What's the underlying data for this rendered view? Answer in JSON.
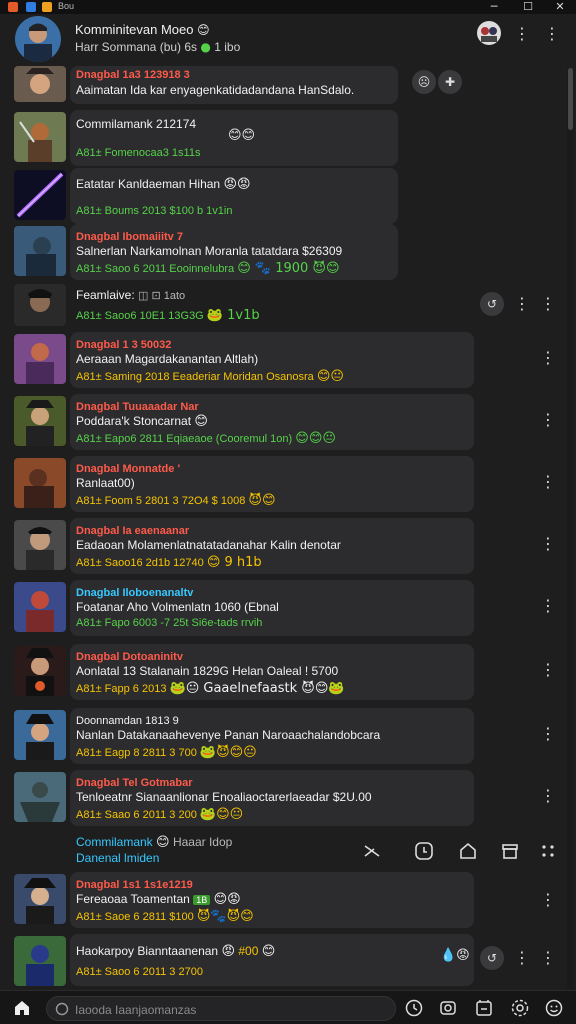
{
  "titlebar": {
    "text": "Bou"
  },
  "header": {
    "title": "Komminitevan Moeo",
    "title_emoji": "😊",
    "subtitle": "Harr Sommana (bu) 6s",
    "subtitle_extra": "1 ibo"
  },
  "messages": [
    {
      "id": "m1",
      "l1": "Dnagbal 1a3 123918 3",
      "l2": "Aaimatan Ida kar enyagenkatidadandana HanSdalo.",
      "l3": "",
      "emojis": ""
    },
    {
      "id": "m2",
      "l1": "Commilamank 212174",
      "l2": "",
      "l3": "A81± Fomenocaa3 1s11s",
      "emojis": "😊😊"
    },
    {
      "id": "m3",
      "l1": "Eatatar Kanldaeman Hihan",
      "l2": "",
      "l3": "A81± Boums 2013 $100 b 1v1in",
      "emojis": "😡😡"
    },
    {
      "id": "m4",
      "l1": "Dnagbal Ibomaiiitv 7",
      "l2": "Salnerlan Narkamolnan Moranla tatatdara $26309",
      "l3": "A81± Saoo 6 2011 Eooinnelubra",
      "emojis": "😊 🐾 1900 😈😊"
    },
    {
      "id": "m5",
      "l1": "Feamlaive:",
      "l2": "",
      "l3": "A81± Saoo6 10E1 13G3G",
      "emojis": "🐸 1v1b"
    },
    {
      "id": "m6",
      "l1": "Dnagbal 1 3 50032",
      "l2": "Aeraaan Magardakanantan Altlah)",
      "l3": "A81± Saming 2018 Eeaderiar Moridan Osanosra",
      "emojis": "😊😐"
    },
    {
      "id": "m7",
      "l1": "Dnagbal Tuuaaadar Nar",
      "l2": "Poddara'k Stoncarnat",
      "l3": "A81± Eapo6 2811 Eqiaeaoe (Cooremul 1on)",
      "emojis": "😊😊😐"
    },
    {
      "id": "m8",
      "l1": "Dnagbal Monnatde '",
      "l2": "Ranlaat00)",
      "l3": "A81± Foom 5 2801 3 72O4 $ 1008",
      "emojis": "😈😊"
    },
    {
      "id": "m9",
      "l1": "Dnagbal Ia eaenaanar",
      "l2": "Eadaoan Molamenlatnatatadanahar Kalin denotar",
      "l3": "A81± Saoo16 2d1b 12740",
      "emojis": "😊 9 h1b"
    },
    {
      "id": "m10",
      "l1": "Dnagbal Iloboenanaltv",
      "l2": "Foatanar Aho Volmenlatn 1060 (Ebnal",
      "l3": "A81± Fapo 6003 -7 25t Si6e-tads rrvih",
      "emojis": ""
    },
    {
      "id": "m11",
      "l1": "Dnagbal Dotoaninitv",
      "l2": "Aonlatal 13 Stalanain 1829G Helan Oaleal ! 5700",
      "l3": "A81± Fapp 6 2013",
      "emojis": "🐸😐 Gaaelnefaastk 😈😊🐸"
    },
    {
      "id": "m12",
      "l1": "Doonnamdan 1813 9",
      "l2": "Nanlan Datakanaahevenye Panan Naroaachalandobcara",
      "l3": "A81± Eagp 8 2811 3 700",
      "emojis": "🐸😈😊😐"
    },
    {
      "id": "m13",
      "l1": "Dnagbal Tel Gotmabar",
      "l2": "Tenloeatnr Sianaanlionar Enoaliaoctarerlaeadar $2U.00",
      "l3": "A81± Saao 6 2011 3 200",
      "emojis": "🐸😊😐"
    },
    {
      "id": "m14",
      "l1": "Dnagbal 1s1 1s1e1219",
      "l2": "Fereaoaa Toamentan",
      "l3": "A81± Saoe 6 2811 $100",
      "emojis": "😈🐾😈😊"
    },
    {
      "id": "m15",
      "l1": "Haokarpoy Bianntaanenan",
      "l2": "",
      "l3": "A81± Saoo 6 2011 3 2700",
      "emojis": ""
    }
  ],
  "toolbar_row": {
    "title": "Commilamank",
    "title_extra": "Haaar Idop",
    "subtitle": "Danenal lmiden"
  },
  "bottom": {
    "search_placeholder": "Iaooda Iaanjaomanzas"
  }
}
